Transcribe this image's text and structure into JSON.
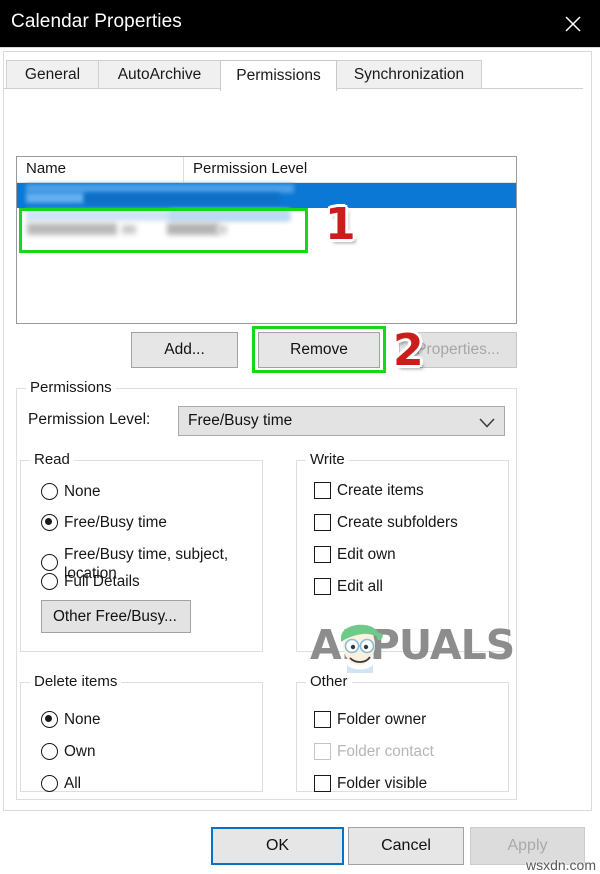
{
  "window": {
    "title": "Calendar Properties",
    "close_icon": "close-icon"
  },
  "tabs": [
    {
      "label": "General",
      "active": false
    },
    {
      "label": "AutoArchive",
      "active": false
    },
    {
      "label": "Permissions",
      "active": true
    },
    {
      "label": "Synchronization",
      "active": false
    }
  ],
  "permission_list": {
    "columns": [
      "Name",
      "Permission Level"
    ],
    "rows": [
      {
        "name": "",
        "level": "",
        "state": "selected-redacted"
      },
      {
        "name": "",
        "level": "",
        "state": "redacted"
      }
    ]
  },
  "list_buttons": {
    "add": "Add...",
    "remove": "Remove",
    "properties": "Properties...",
    "properties_enabled": false
  },
  "annotations": [
    {
      "step": "1",
      "target": "permission-list-row-2"
    },
    {
      "step": "2",
      "target": "remove-button"
    }
  ],
  "permissions_group": {
    "legend": "Permissions",
    "permission_level_label": "Permission Level:",
    "permission_level_value": "Free/Busy time",
    "permission_level_options": [
      "Free/Busy time"
    ],
    "read": {
      "legend": "Read",
      "options": [
        {
          "label": "None",
          "checked": false
        },
        {
          "label": "Free/Busy time",
          "checked": true
        },
        {
          "label": "Free/Busy time, subject,\nlocation",
          "checked": false
        },
        {
          "label": "Full Details",
          "checked": false
        }
      ],
      "other_free_busy_button": "Other Free/Busy..."
    },
    "write": {
      "legend": "Write",
      "options": [
        {
          "label": "Create items",
          "checked": false
        },
        {
          "label": "Create subfolders",
          "checked": false
        },
        {
          "label": "Edit own",
          "checked": false
        },
        {
          "label": "Edit all",
          "checked": false
        }
      ]
    },
    "delete_items": {
      "legend": "Delete items",
      "options": [
        {
          "label": "None",
          "checked": true
        },
        {
          "label": "Own",
          "checked": false
        },
        {
          "label": "All",
          "checked": false
        }
      ]
    },
    "other": {
      "legend": "Other",
      "options": [
        {
          "label": "Folder owner",
          "checked": false,
          "enabled": true
        },
        {
          "label": "Folder contact",
          "checked": false,
          "enabled": false
        },
        {
          "label": "Folder visible",
          "checked": false,
          "enabled": true
        }
      ]
    }
  },
  "footer": {
    "ok": "OK",
    "cancel": "Cancel",
    "apply": "Apply",
    "apply_enabled": false
  },
  "watermarks": {
    "brand": "APPUALS",
    "site": "wsxdn.com"
  },
  "colors": {
    "titlebar": "#000000",
    "selection_blue": "#0a78d4",
    "highlight_green": "#16d81a",
    "badge_red": "#cc1d1d",
    "focus_blue": "#0a72c4"
  }
}
